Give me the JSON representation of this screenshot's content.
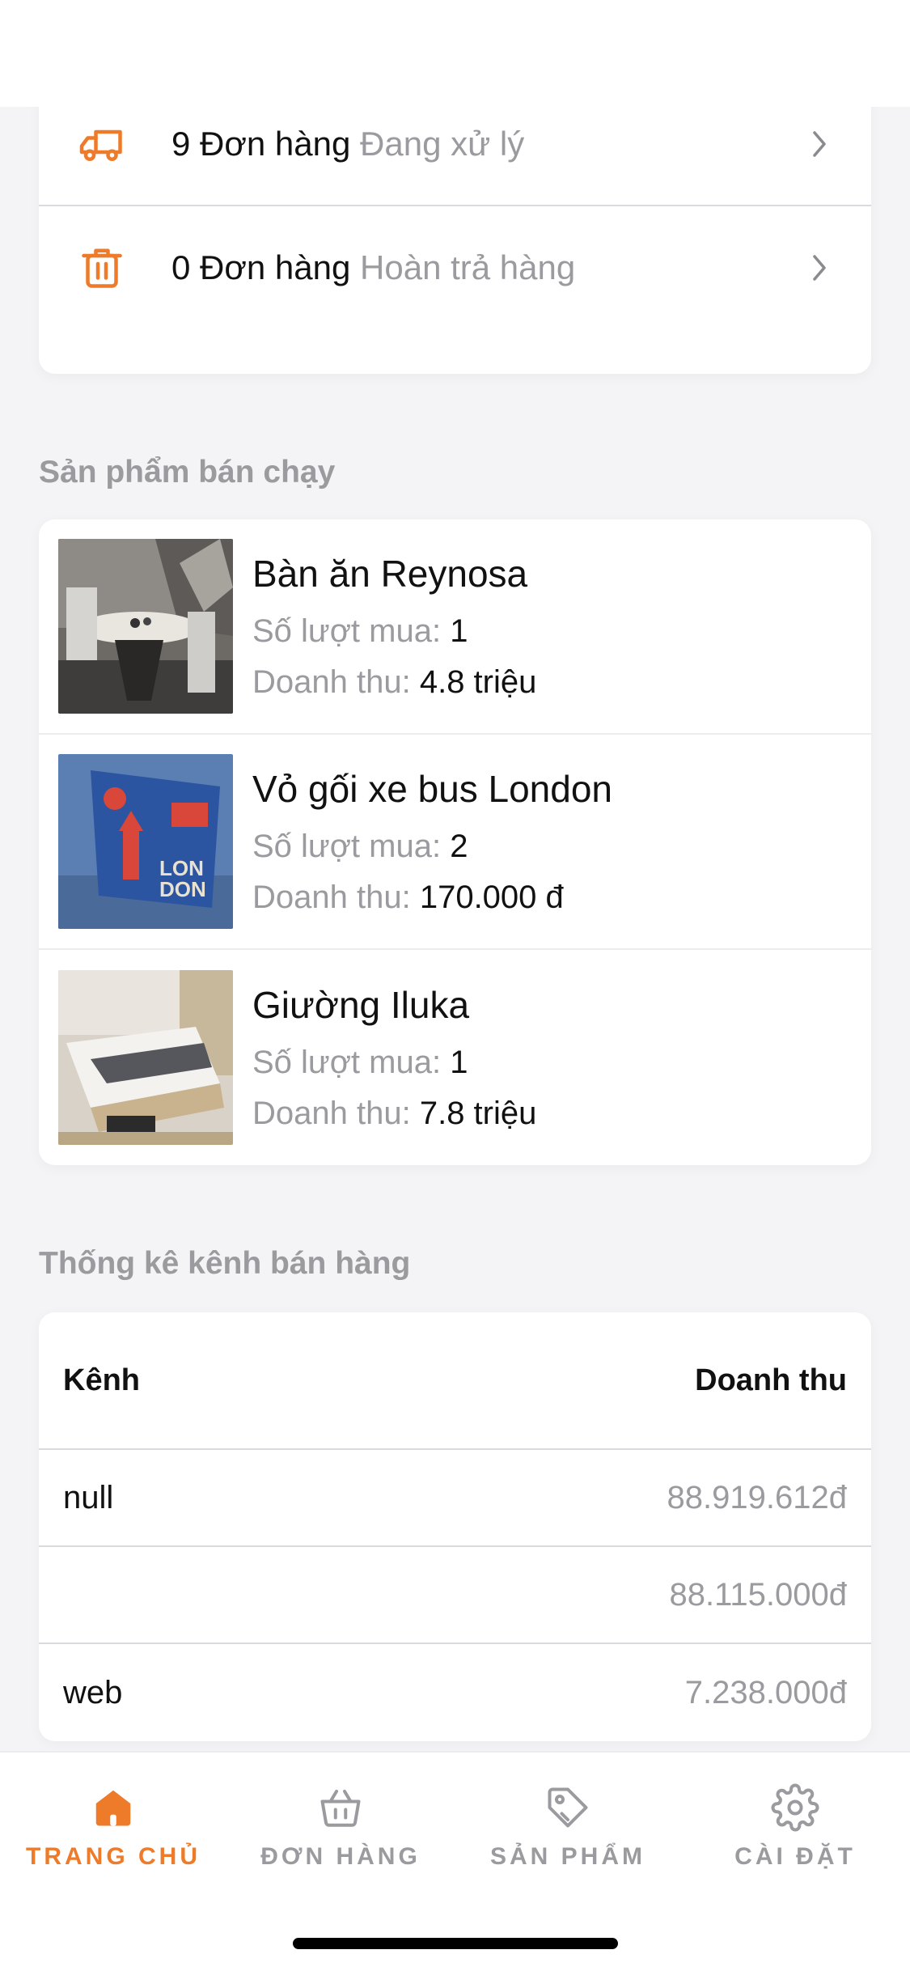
{
  "orders": [
    {
      "count_label": "9 Đơn hàng",
      "status": "Đang xử lý",
      "icon": "truck-icon"
    },
    {
      "count_label": "0 Đơn hàng",
      "status": "Hoàn trả hàng",
      "icon": "trash-icon"
    }
  ],
  "best_sellers": {
    "title": "Sản phẩm bán chạy",
    "buys_label": "Số lượt mua:",
    "revenue_label": "Doanh thu:",
    "items": [
      {
        "name": "Bàn ăn Reynosa",
        "buys": "1",
        "revenue": "4.8 triệu"
      },
      {
        "name": "Vỏ gối xe bus London",
        "buys": "2",
        "revenue": "170.000 đ"
      },
      {
        "name": "Giường Iluka",
        "buys": "1",
        "revenue": "7.8 triệu"
      }
    ]
  },
  "channels": {
    "title": "Thống kê kênh bán hàng",
    "col_channel": "Kênh",
    "col_revenue": "Doanh thu",
    "rows": [
      {
        "name": "null",
        "revenue": "88.919.612đ"
      },
      {
        "name": "",
        "revenue": "88.115.000đ"
      },
      {
        "name": "web",
        "revenue": "7.238.000đ"
      }
    ]
  },
  "tabs": [
    {
      "label": "TRANG CHỦ",
      "icon": "home-icon",
      "active": true
    },
    {
      "label": "ĐƠN HÀNG",
      "icon": "basket-icon",
      "active": false
    },
    {
      "label": "SẢN PHẨM",
      "icon": "tag-icon",
      "active": false
    },
    {
      "label": "CÀI ĐẶT",
      "icon": "gear-icon",
      "active": false
    }
  ],
  "colors": {
    "accent": "#ee7b2a",
    "muted": "#9a9a9f",
    "background": "#f4f4f6"
  }
}
